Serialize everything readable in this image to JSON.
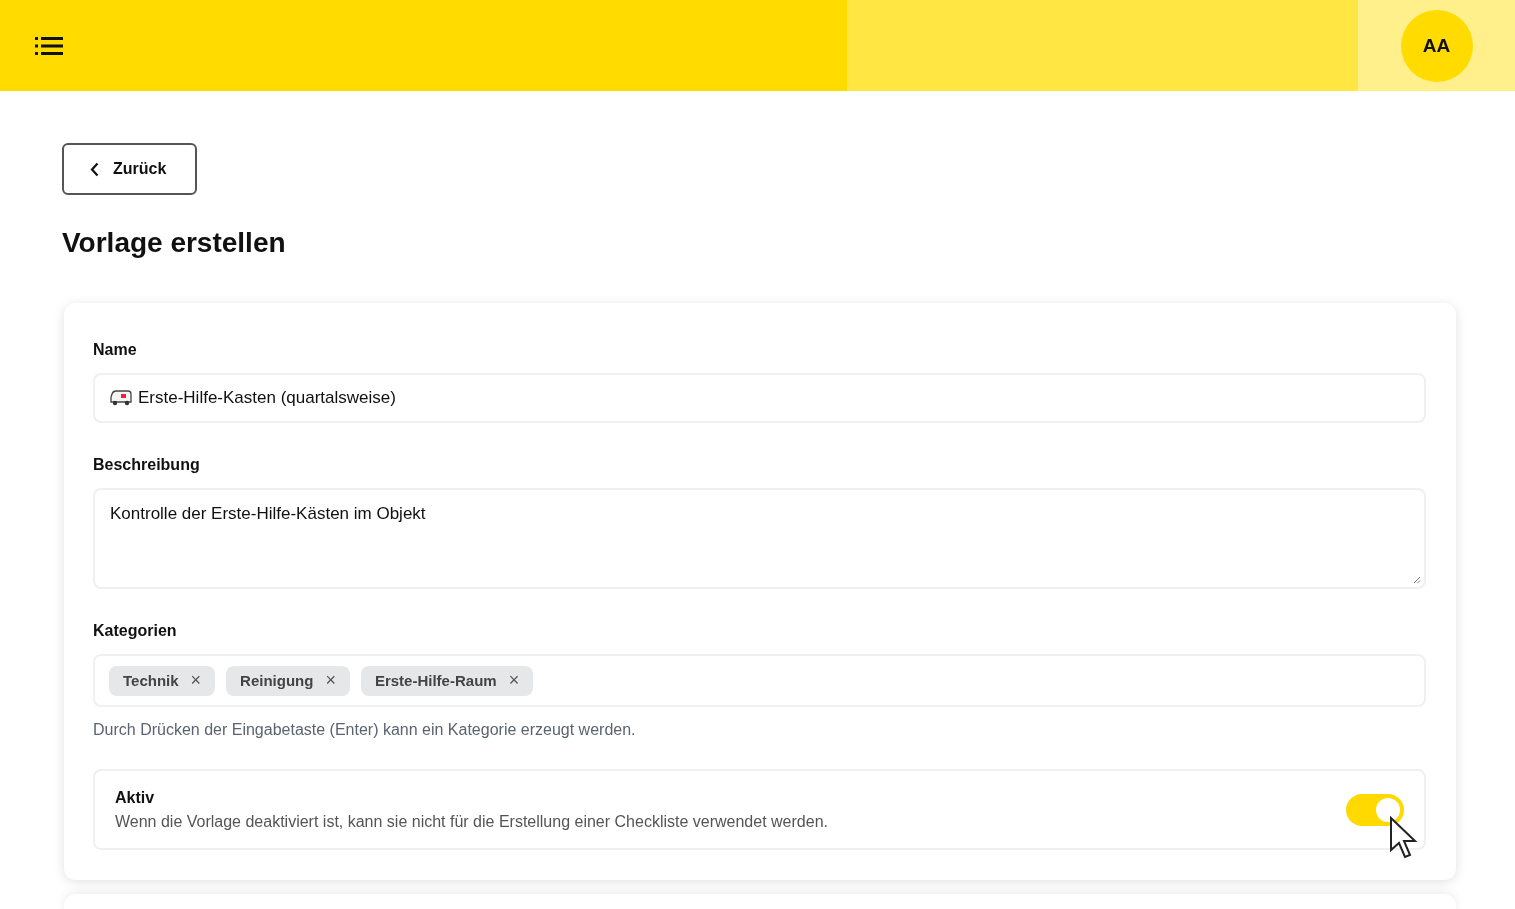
{
  "header": {
    "avatar": "AA"
  },
  "back_button": "Zurück",
  "page_title": "Vorlage erstellen",
  "form": {
    "name": {
      "label": "Name",
      "value": "Erste-Hilfe-Kasten (quartalsweise)"
    },
    "description": {
      "label": "Beschreibung",
      "value": "Kontrolle der Erste-Hilfe-Kästen im Objekt"
    },
    "categories": {
      "label": "Kategorien",
      "chips": [
        "Technik",
        "Reinigung",
        "Erste-Hilfe-Raum"
      ],
      "remove_glyph": "×",
      "hint": "Durch Drücken der Eingabetaste (Enter) kann ein Kategorie erzeugt werden."
    },
    "active": {
      "label": "Aktiv",
      "description": "Wenn die Vorlage deaktiviert ist, kann sie nicht für die Erstellung einer Checkliste verwendet werden.",
      "on": true
    }
  }
}
